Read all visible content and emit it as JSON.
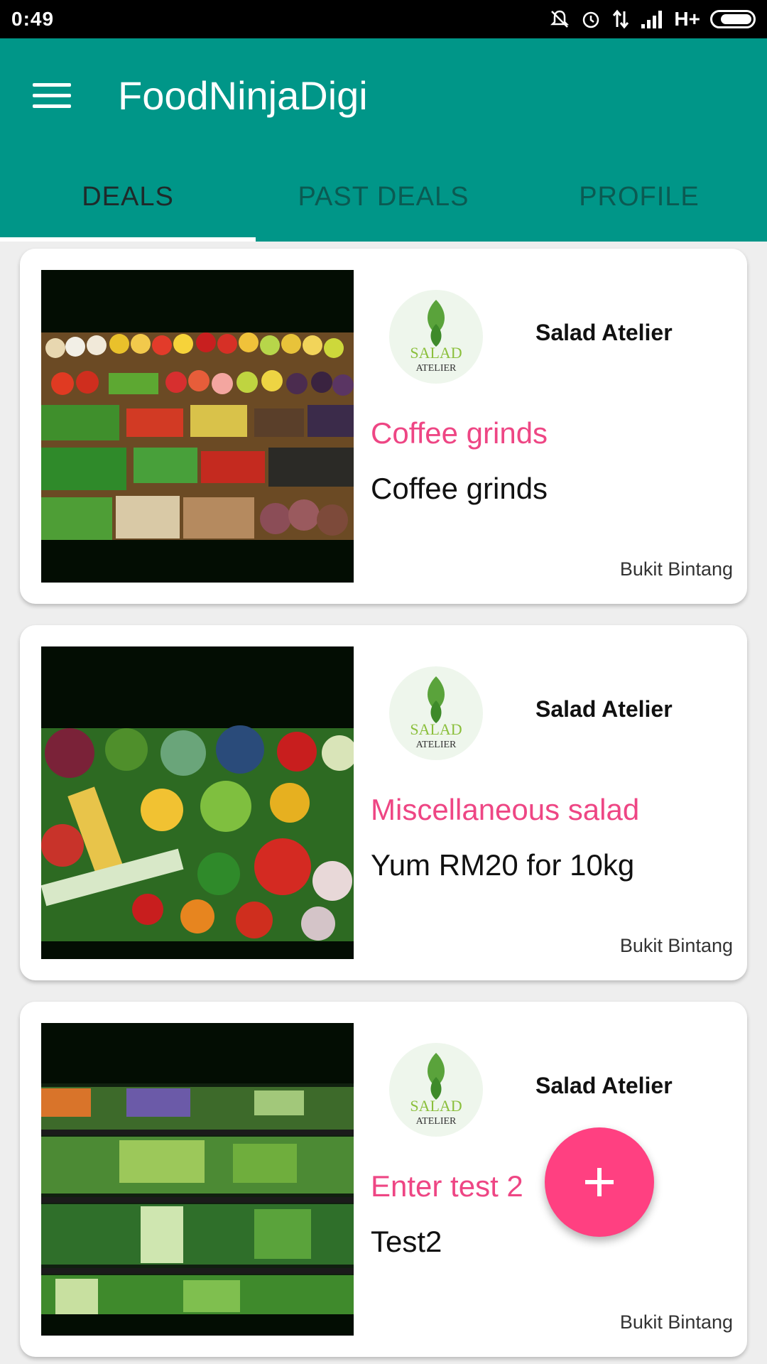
{
  "status_bar": {
    "time": "0:49",
    "network": "H+",
    "icons": [
      "mute-icon",
      "alarm-icon",
      "data-arrows-icon",
      "signal-icon",
      "battery-icon"
    ],
    "battery_level": 0.85
  },
  "app_bar": {
    "title": "FoodNinjaDigi",
    "menu_icon": "hamburger-menu-icon",
    "color": "#009688"
  },
  "tabs": [
    {
      "label": "DEALS",
      "active": true
    },
    {
      "label": "PAST DEALS",
      "active": false
    },
    {
      "label": "PROFILE",
      "active": false
    }
  ],
  "deals": [
    {
      "vendor": "Salad Atelier",
      "title": "Coffee grinds",
      "description": "Coffee grinds",
      "location": "Bukit Bintang",
      "image": "vegetable-market-photo"
    },
    {
      "vendor": "Salad Atelier",
      "title": "Miscellaneous salad",
      "description": "Yum RM20 for 10kg",
      "location": "Bukit Bintang",
      "image": "assorted-vegetables-photo"
    },
    {
      "vendor": "Salad Atelier",
      "title": "Enter test 2",
      "description": "Test2",
      "location": "Bukit Bintang",
      "image": "grocery-shelf-photo"
    }
  ],
  "logo_text": {
    "line1": "SALAD",
    "line2": "ATELIER"
  },
  "fab": {
    "icon": "plus-icon",
    "color": "#ff4081"
  },
  "colors": {
    "primary": "#009688",
    "accent": "#ff4081",
    "deal_title": "#ee4684"
  }
}
